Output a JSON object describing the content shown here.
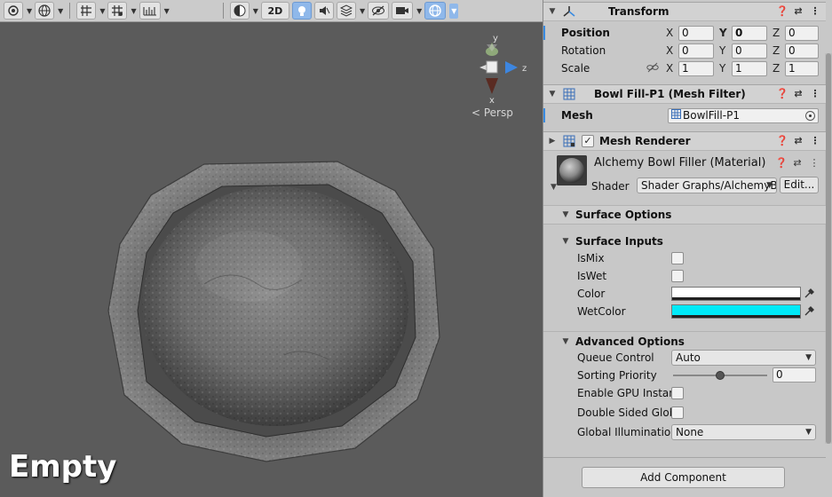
{
  "scene": {
    "toolbar": {
      "mode_2d": "2D"
    },
    "gizmo": {
      "y": "y",
      "z": "z",
      "x": "x"
    },
    "projection": "< Persp",
    "overlay_label": "Empty"
  },
  "inspector": {
    "transform": {
      "title": "Transform",
      "position": {
        "label": "Position",
        "x": "0",
        "y": "0",
        "z": "0"
      },
      "rotation": {
        "label": "Rotation",
        "x": "0",
        "y": "0",
        "z": "0"
      },
      "scale": {
        "label": "Scale",
        "x": "1",
        "y": "1",
        "z": "1"
      },
      "axis_x": "X",
      "axis_y": "Y",
      "axis_z": "Z"
    },
    "mesh_filter": {
      "title": "Bowl Fill-P1 (Mesh Filter)",
      "mesh_label": "Mesh",
      "mesh_value": "BowlFill-P1"
    },
    "mesh_renderer": {
      "title": "Mesh Renderer",
      "enabled": true
    },
    "material": {
      "title": "Alchemy Bowl Filler (Material)",
      "shader_label": "Shader",
      "shader_value": "Shader Graphs/AlchemyB",
      "edit_button": "Edit..."
    },
    "surface_options": {
      "title": "Surface Options"
    },
    "surface_inputs": {
      "title": "Surface Inputs",
      "is_mix": "IsMix",
      "is_wet": "IsWet",
      "color_label": "Color",
      "color_value": "#ffffff",
      "wet_color_label": "WetColor",
      "wet_color_value": "#00eaf8"
    },
    "advanced_options": {
      "title": "Advanced Options",
      "queue_control_label": "Queue Control",
      "queue_control_value": "Auto",
      "sorting_priority_label": "Sorting Priority",
      "sorting_priority_value": "0",
      "sorting_priority_slider": 0.5,
      "gpu_instancing_label": "Enable GPU Instan",
      "double_sided_label": "Double Sided Glob",
      "global_illumination_label": "Global Illumination",
      "global_illumination_value": "None"
    },
    "add_component": "Add Component"
  },
  "colors": {
    "scene_bg": "#5b5b5b",
    "inspector_bg": "#c8c8c8",
    "accent_blue": "#3a8be0",
    "gizmo_z": "#3d86e0",
    "gizmo_y": "#8fa97a",
    "gizmo_x": "#5a2b22"
  }
}
